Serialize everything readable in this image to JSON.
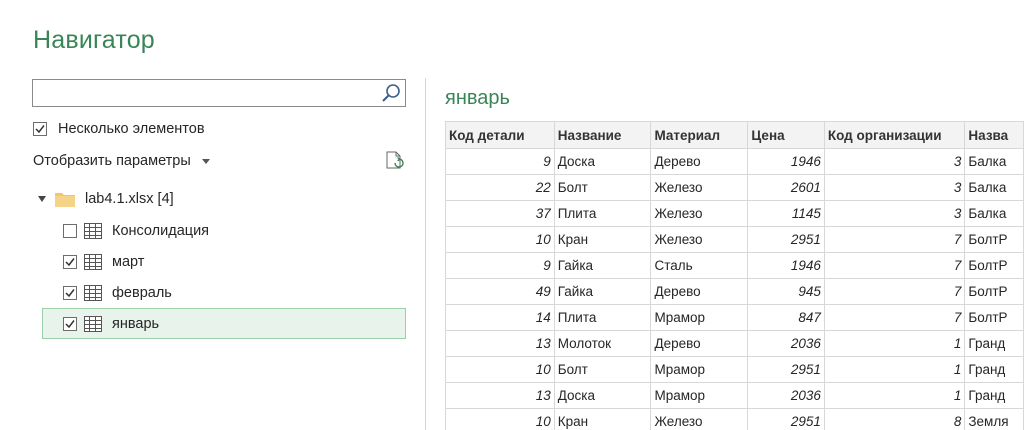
{
  "navigator": {
    "title": "Навигатор",
    "search": {
      "value": "",
      "placeholder": ""
    },
    "multi_select": {
      "label": "Несколько элементов",
      "checked": true
    },
    "display_options": {
      "label": "Отобразить параметры"
    },
    "tree": {
      "root_label": "lab4.1.xlsx [4]",
      "items": [
        {
          "label": "Консолидация",
          "checked": false,
          "selected": false
        },
        {
          "label": "март",
          "checked": true,
          "selected": false
        },
        {
          "label": "февраль",
          "checked": true,
          "selected": false
        },
        {
          "label": "январь",
          "checked": true,
          "selected": true
        }
      ]
    }
  },
  "preview": {
    "title": "январь",
    "columns": [
      "Код детали",
      "Название",
      "Материал",
      "Цена",
      "Код организации",
      "Назва"
    ],
    "rows": [
      [
        "9",
        "Доска",
        "Дерево",
        "1946",
        "3",
        "Балка"
      ],
      [
        "22",
        "Болт",
        "Железо",
        "2601",
        "3",
        "Балка"
      ],
      [
        "37",
        "Плита",
        "Железо",
        "1145",
        "3",
        "Балка"
      ],
      [
        "10",
        "Кран",
        "Железо",
        "2951",
        "7",
        "БолтР"
      ],
      [
        "9",
        "Гайка",
        "Сталь",
        "1946",
        "7",
        "БолтР"
      ],
      [
        "49",
        "Гайка",
        "Дерево",
        "945",
        "7",
        "БолтР"
      ],
      [
        "14",
        "Плита",
        "Мрамор",
        "847",
        "7",
        "БолтР"
      ],
      [
        "13",
        "Молоток",
        "Дерево",
        "2036",
        "1",
        "Гранд"
      ],
      [
        "10",
        "Болт",
        "Мрамор",
        "2951",
        "1",
        "Гранд"
      ],
      [
        "13",
        "Доска",
        "Мрамор",
        "2036",
        "1",
        "Гранд"
      ],
      [
        "10",
        "Кран",
        "Железо",
        "2951",
        "8",
        "Земля"
      ]
    ]
  },
  "colors": {
    "accent": "#3a8557",
    "selection_bg": "#e8f3ec",
    "selection_border": "#9acfa9"
  }
}
